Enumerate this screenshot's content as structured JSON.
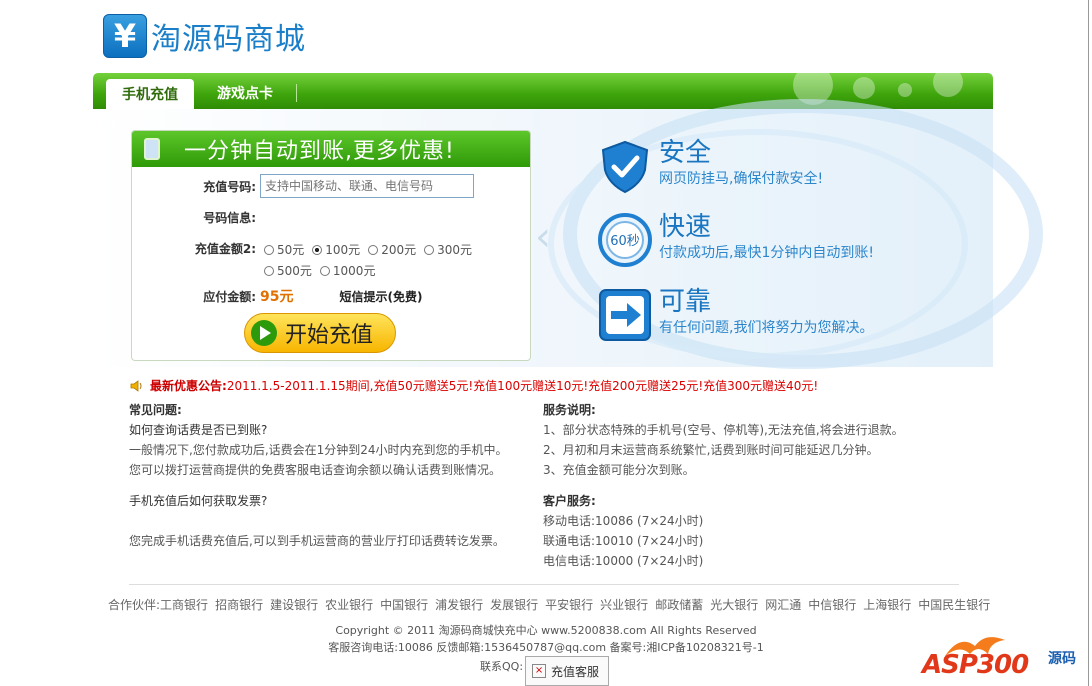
{
  "header": {
    "logo_symbol": "¥",
    "site_name": "淘源码商城"
  },
  "nav": {
    "tabs": [
      {
        "label": "手机充值",
        "active": true
      },
      {
        "label": "游戏点卡",
        "active": false
      }
    ]
  },
  "form": {
    "title": "一分钟自动到账,更多优惠!",
    "phone_label": "充值号码:",
    "phone_placeholder": "支持中国移动、联通、电信号码",
    "info_label": "号码信息:",
    "amount_label": "充值金额2:",
    "amount_options": [
      {
        "label": "50元",
        "selected": false
      },
      {
        "label": "100元",
        "selected": true
      },
      {
        "label": "200元",
        "selected": false
      },
      {
        "label": "300元",
        "selected": false
      },
      {
        "label": "500元",
        "selected": false
      },
      {
        "label": "1000元",
        "selected": false
      }
    ],
    "pay_label": "应付金额:",
    "pay_value": "95元",
    "sms_hint": "短信提示(免费)",
    "start_button": "开始充值"
  },
  "features": [
    {
      "icon": "shield-check-icon",
      "title": "安全",
      "desc": "网页防挂马,确保付款安全!"
    },
    {
      "icon": "clock-60s-icon",
      "title": "快速",
      "desc": "付款成功后,最快1分钟内自动到账!"
    },
    {
      "icon": "arrow-right-icon",
      "title": "可靠",
      "desc": "有任何问题,我们将努力为您解决。"
    }
  ],
  "notice": {
    "label": "最新优惠公告:",
    "text": "2011.1.5-2011.1.15期间,充值50元赠送5元!充值100元赠送10元!充值200元赠送25元!充值300元赠送40元!"
  },
  "faq": {
    "title": "常见问题:",
    "q1": "如何查询话费是否已到账?",
    "a1_1": "一般情况下,您付款成功后,话费会在1分钟到24小时内充到您的手机中。",
    "a1_2": "您可以拨打运营商提供的免费客服电话查询余额以确认话费到账情况。",
    "q2": "手机充值后如何获取发票?",
    "a2": "您完成手机话费充值后,可以到手机运营商的营业厅打印话费转讫发票。"
  },
  "service": {
    "title": "服务说明:",
    "items": [
      "1、部分状态特殊的手机号(空号、停机等),无法充值,将会进行退款。",
      "2、月初和月末运营商系统繁忙,话费到账时间可能延迟几分钟。",
      "3、充值金额可能分次到账。"
    ]
  },
  "support": {
    "title": "客户服务:",
    "items": [
      "移动电话:10086 (7×24小时)",
      "联通电话:10010 (7×24小时)",
      "电信电话:10000 (7×24小时)"
    ]
  },
  "footer": {
    "partners_label": "合作伙伴:",
    "partners": [
      "工商银行",
      "招商银行",
      "建设银行",
      "农业银行",
      "中国银行",
      "浦发银行",
      "发展银行",
      "平安银行",
      "兴业银行",
      "邮政储蓄",
      "光大银行",
      "网汇通",
      "中信银行",
      "上海银行",
      "中国民生银行"
    ],
    "copyright": "Copyright © 2011 淘源码商城快充中心 www.5200838.com All Rights Reserved",
    "contact": "客服咨询电话:10086  反馈邮箱:1536450787@qq.com   备案号:湘ICP备10208321号-1",
    "qq_label": "联系QQ:",
    "qq_button": "充值客服"
  },
  "watermark": {
    "text": "ASP300",
    "cn": "源码"
  }
}
